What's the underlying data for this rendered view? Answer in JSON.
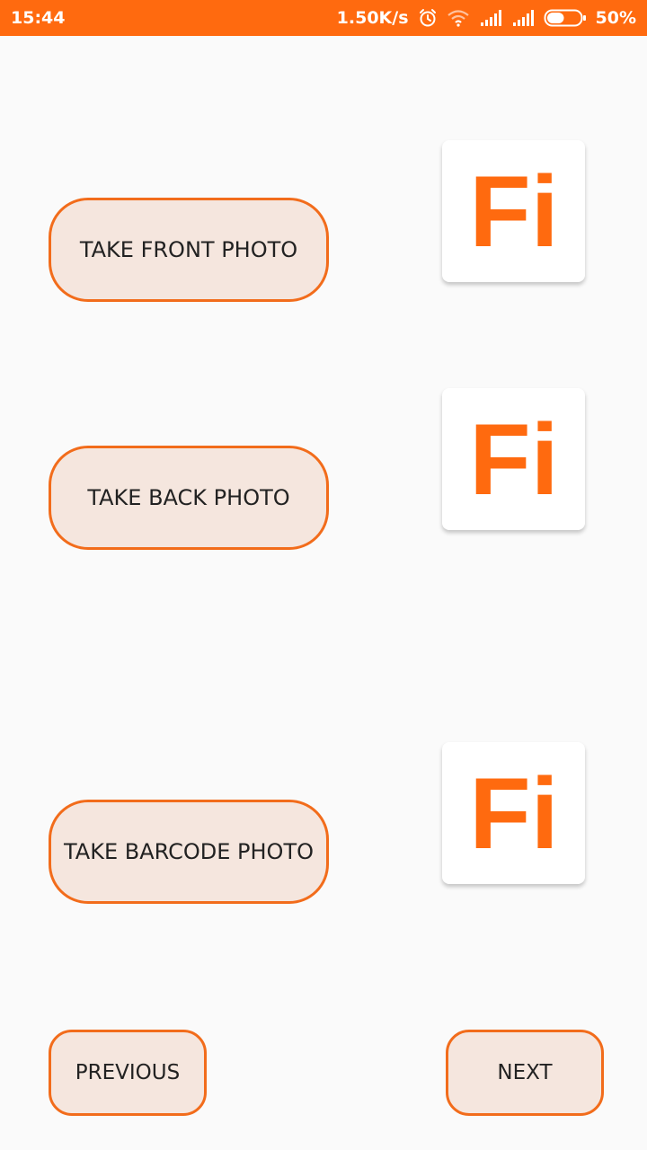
{
  "status_bar": {
    "time": "15:44",
    "network_speed": "1.50K/s",
    "battery_percent": "50%",
    "battery_level": 0.5,
    "icons": [
      "alarm-icon",
      "wifi-icon",
      "signal-icon",
      "signal-icon",
      "battery-icon"
    ]
  },
  "buttons": {
    "front_label": "TAKE FRONT PHOTO",
    "back_label": "TAKE BACK PHOTO",
    "barcode_label": "TAKE BARCODE PHOTO"
  },
  "placeholder_logo": {
    "text": "Fi",
    "color": "#ff6a0f"
  },
  "nav": {
    "previous_label": "PREVIOUS",
    "next_label": "NEXT"
  },
  "colors": {
    "accent": "#ff6a0f",
    "button_fill": "#f5e6de",
    "button_border": "#f26c1b",
    "background": "#fafafa"
  }
}
